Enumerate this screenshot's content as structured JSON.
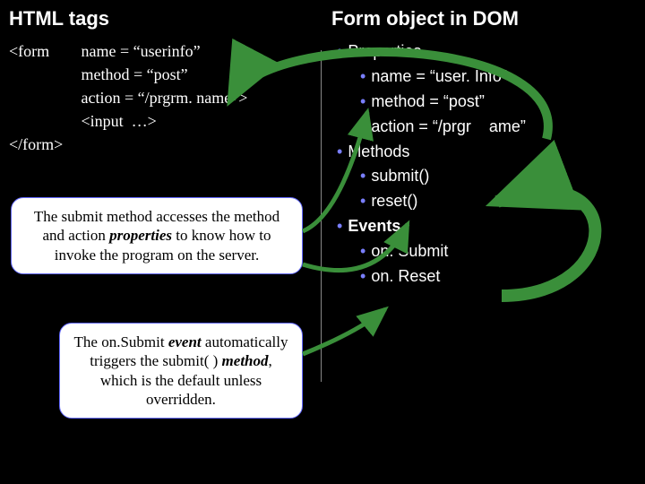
{
  "left": {
    "title": "HTML tags",
    "form_open": "<form",
    "attrs": {
      "name": "name = “userinfo”",
      "method": "method = “post”",
      "action": "action = “/prgrm. name”>",
      "input": "<input  …>"
    },
    "form_close": "</form>",
    "callout1_pre": "The submit method accesses the method and action ",
    "callout1_em": "properties",
    "callout1_post": " to know how to invoke the program on the server.",
    "callout2_l1a": "The on.Submit ",
    "callout2_l1em": "event",
    "callout2_l2a": " automatically triggers the submit( ) ",
    "callout2_l2em": "method",
    "callout2_l3": ", which is the default unless overridden."
  },
  "right": {
    "title": "Form object in DOM",
    "properties_label": "Properties",
    "p_name": "name = “user. Info”",
    "p_method": "method = “post”",
    "p_action": "action = “/prgr    ame”",
    "methods_label": "Methods",
    "m_submit": "submit()",
    "m_reset": "reset()",
    "events_label": "Events",
    "e_onsubmit": "on. Submit",
    "e_onreset": "on. Reset"
  }
}
